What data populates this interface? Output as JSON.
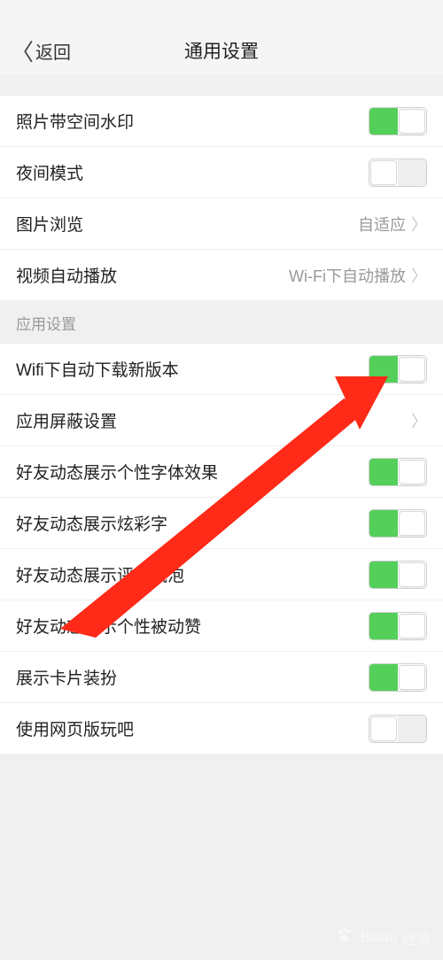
{
  "status_bar": {
    "time": ""
  },
  "nav": {
    "back": "返回",
    "title": "通用设置"
  },
  "section1": {
    "rows": [
      {
        "label": "照片带空间水印",
        "type": "switch",
        "on": true
      },
      {
        "label": "夜间模式",
        "type": "switch",
        "on": false
      },
      {
        "label": "图片浏览",
        "type": "link",
        "value": "自适应"
      },
      {
        "label": "视频自动播放",
        "type": "link",
        "value": "Wi-Fi下自动播放"
      }
    ]
  },
  "section2": {
    "header": "应用设置",
    "rows": [
      {
        "label": "Wifi下自动下载新版本",
        "type": "switch",
        "on": true
      },
      {
        "label": "应用屏蔽设置",
        "type": "link",
        "value": ""
      },
      {
        "label": "好友动态展示个性字体效果",
        "type": "switch",
        "on": true
      },
      {
        "label": "好友动态展示炫彩字",
        "type": "switch",
        "on": true
      },
      {
        "label": "好友动态展示评论气泡",
        "type": "switch",
        "on": true
      },
      {
        "label": "好友动态展示个性被动赞",
        "type": "switch",
        "on": true
      },
      {
        "label": "展示卡片装扮",
        "type": "switch",
        "on": true
      },
      {
        "label": "使用网页版玩吧",
        "type": "switch",
        "on": false
      }
    ]
  },
  "watermark": {
    "brand": "Baidu",
    "suffix": "经验"
  },
  "colors": {
    "accent": "#54d05a",
    "arrow": "#ff2a17"
  }
}
